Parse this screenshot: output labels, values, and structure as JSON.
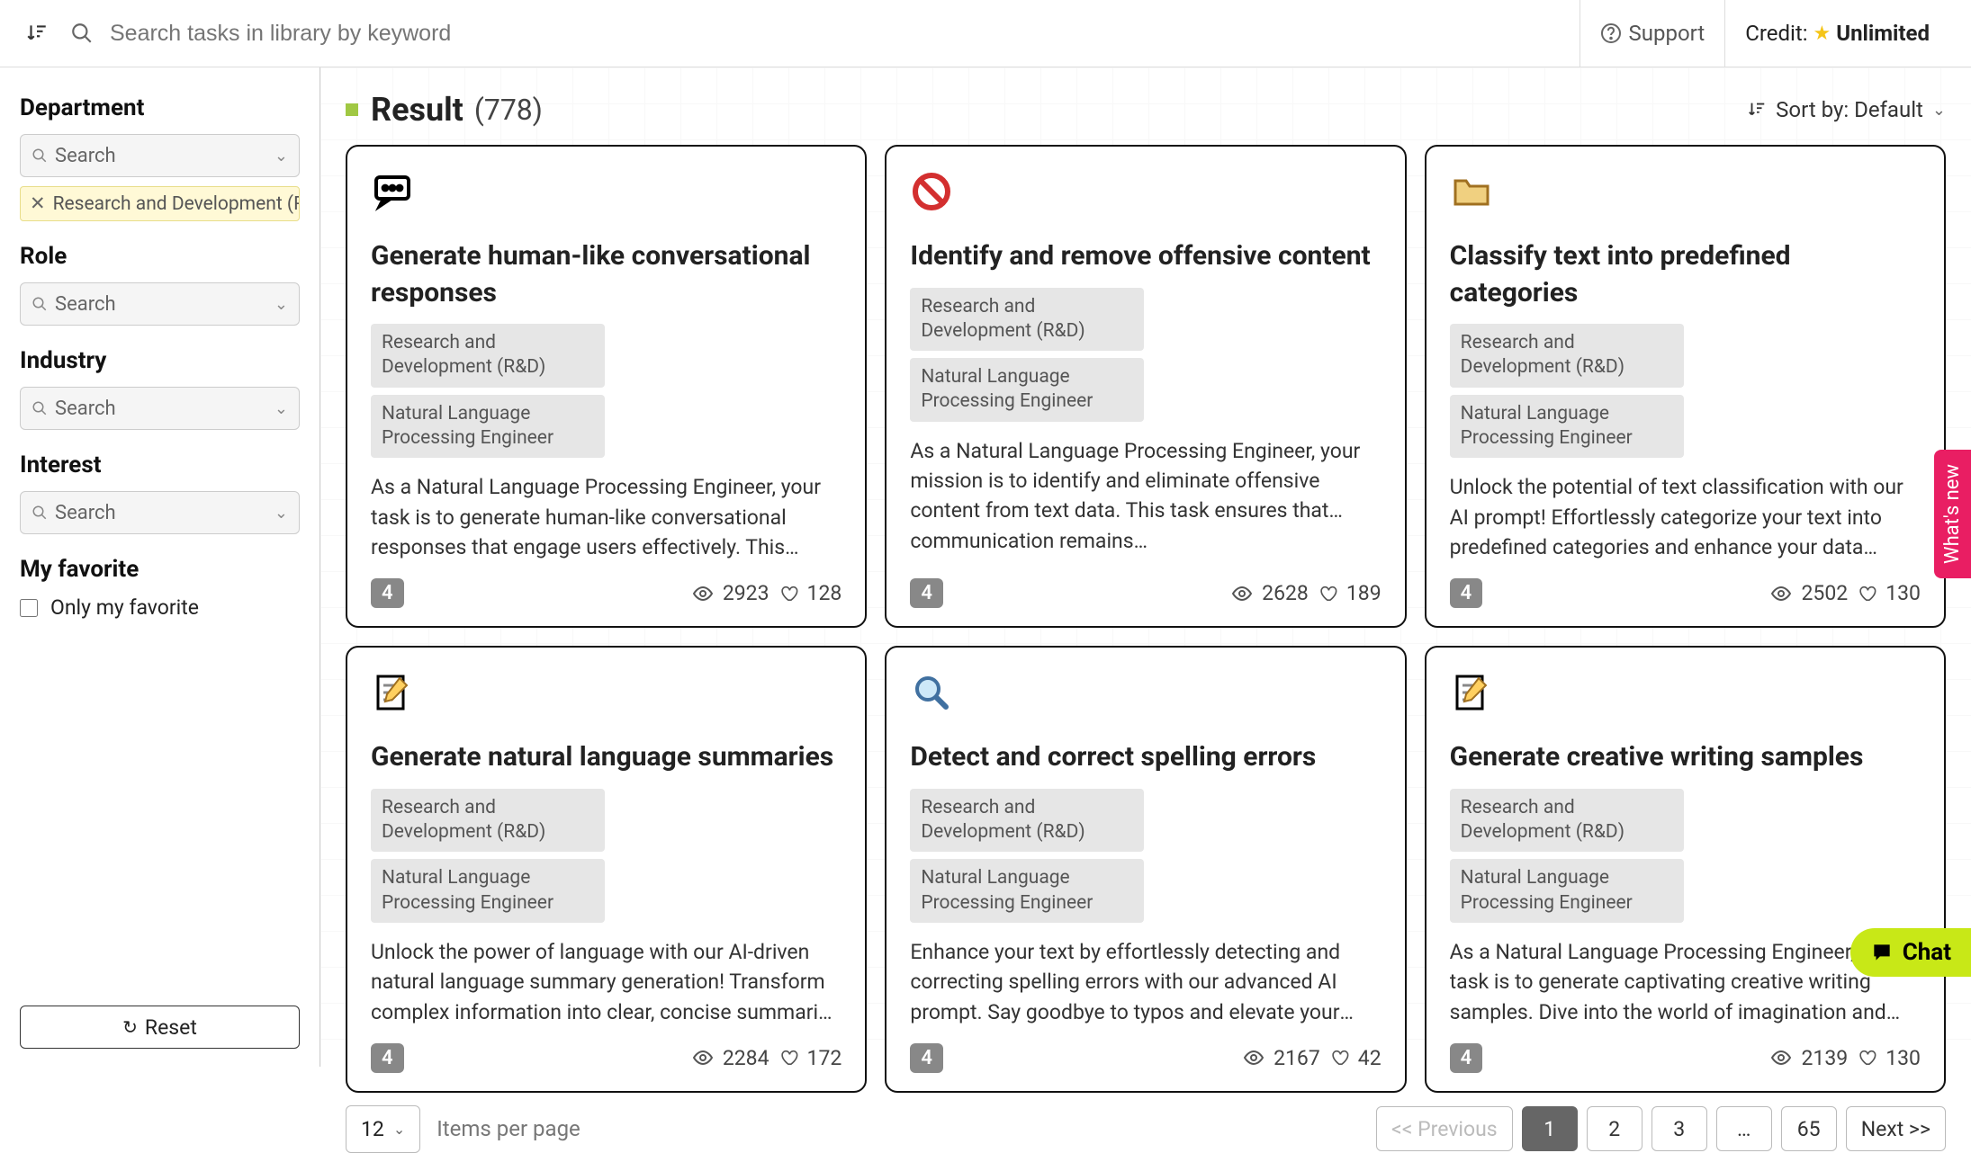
{
  "topbar": {
    "search_placeholder": "Search tasks in library by keyword",
    "support_label": "Support",
    "credit_label": "Credit:",
    "credit_value": "Unlimited"
  },
  "sidebar": {
    "department": {
      "title": "Department",
      "placeholder": "Search",
      "chip": "Research and Development (R&…"
    },
    "role": {
      "title": "Role",
      "placeholder": "Search"
    },
    "industry": {
      "title": "Industry",
      "placeholder": "Search"
    },
    "interest": {
      "title": "Interest",
      "placeholder": "Search"
    },
    "favorite": {
      "title": "My favorite",
      "checkbox_label": "Only my favorite"
    },
    "reset_label": "Reset"
  },
  "result": {
    "title": "Result",
    "count": "(778)",
    "sort_label": "Sort by: Default"
  },
  "cards": [
    {
      "title": "Generate human-like conversational responses",
      "tag1": "Research and Development (R&D)",
      "tag2": "Natural Language Processing Engineer",
      "desc": "As a Natural Language Processing Engineer, your task is to generate human-like conversational responses that engage users effectively. This prompt empowers you to…",
      "badge": "4",
      "views": "2923",
      "likes": "128",
      "icon": "speech"
    },
    {
      "title": "Identify and remove offensive content",
      "tag1": "Research and Development (R&D)",
      "tag2": "Natural Language Processing Engineer",
      "desc": "As a Natural Language Processing Engineer, your mission is to identify and eliminate offensive content from text data. This task ensures that communication remains…",
      "badge": "4",
      "views": "2628",
      "likes": "189",
      "icon": "prohibit"
    },
    {
      "title": "Classify text into predefined categories",
      "tag1": "Research and Development (R&D)",
      "tag2": "Natural Language Processing Engineer",
      "desc": "Unlock the potential of text classification with our AI prompt! Effortlessly categorize your text into predefined categories and enhance your data analysis.",
      "badge": "4",
      "views": "2502",
      "likes": "130",
      "icon": "folder"
    },
    {
      "title": "Generate natural language summaries",
      "tag1": "Research and Development (R&D)",
      "tag2": "Natural Language Processing Engineer",
      "desc": "Unlock the power of language with our AI-driven natural language summary generation! Transform complex information into clear, concise summaries that enhance…",
      "badge": "4",
      "views": "2284",
      "likes": "172",
      "icon": "note"
    },
    {
      "title": "Detect and correct spelling errors",
      "tag1": "Research and Development (R&D)",
      "tag2": "Natural Language Processing Engineer",
      "desc": "Enhance your text by effortlessly detecting and correcting spelling errors with our advanced AI prompt. Say goodbye to typos and elevate your writing quality in no time!",
      "badge": "4",
      "views": "2167",
      "likes": "42",
      "icon": "magnify"
    },
    {
      "title": "Generate creative writing samples",
      "tag1": "Research and Development (R&D)",
      "tag2": "Natural Language Processing Engineer",
      "desc": "As a Natural Language Processing Engineer, your task is to generate captivating creative writing samples. Dive into the world of imagination and craft unique narrative…",
      "badge": "4",
      "views": "2139",
      "likes": "130",
      "icon": "note"
    }
  ],
  "pagination": {
    "items_per_page": "12",
    "items_per_page_label": "Items per page",
    "prev": "<< Previous",
    "pages": [
      "1",
      "2",
      "3",
      "…",
      "65"
    ],
    "active": "1",
    "next": "Next >>"
  },
  "floats": {
    "whats_new": "What's new",
    "chat": "Chat"
  }
}
